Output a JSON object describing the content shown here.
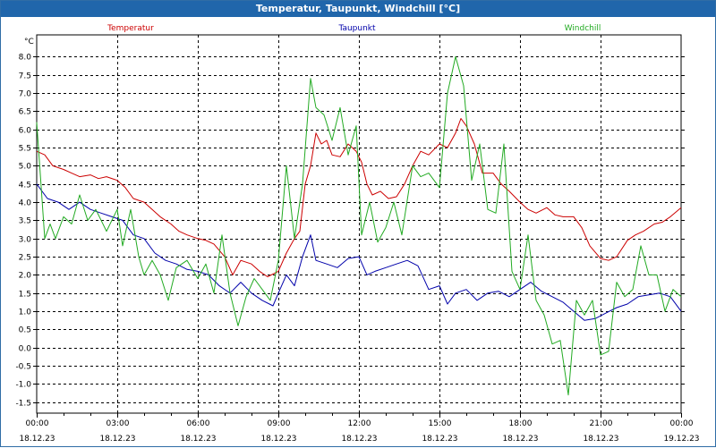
{
  "window": {
    "title": "Temperatur, Taupunkt, Windchill [°C]"
  },
  "chart_data": {
    "type": "line",
    "title": "Temperatur, Taupunkt, Windchill [°C]",
    "ylabel": "°C",
    "ylim": [
      -1.8,
      8.6
    ],
    "yticks": [
      8.0,
      7.5,
      7.0,
      6.5,
      6.0,
      5.5,
      5.0,
      4.5,
      4.0,
      3.5,
      3.0,
      2.5,
      2.0,
      1.5,
      1.0,
      0.5,
      0.0,
      -0.5,
      -1.0,
      -1.5
    ],
    "ytick_labels": [
      "8.0",
      "7.5",
      "7.0",
      "6.5",
      "6.0",
      "5.5",
      "5.0",
      "4.5",
      "4.0",
      "3.5",
      "3.0",
      "2.5",
      "2.0",
      "1.5",
      "1.0",
      "0.5",
      "0.0",
      "-0.5",
      "-1.0",
      "-1.5"
    ],
    "xlim": [
      0,
      24
    ],
    "xticks": [
      {
        "x": 0,
        "time": "00:00",
        "date": "18.12.23"
      },
      {
        "x": 3,
        "time": "03:00",
        "date": "18.12.23"
      },
      {
        "x": 6,
        "time": "06:00",
        "date": "18.12.23"
      },
      {
        "x": 9,
        "time": "09:00",
        "date": "18.12.23"
      },
      {
        "x": 12,
        "time": "12:00",
        "date": "18.12.23"
      },
      {
        "x": 15,
        "time": "15:00",
        "date": "18.12.23"
      },
      {
        "x": 18,
        "time": "18:00",
        "date": "18.12.23"
      },
      {
        "x": 21,
        "time": "21:00",
        "date": "18.12.23"
      },
      {
        "x": 24,
        "time": "00:00",
        "date": "19.12.23"
      }
    ],
    "grid": true,
    "legend_position": "top",
    "series": [
      {
        "name": "Temperatur",
        "color": "#cc0000",
        "points": [
          [
            0,
            5.4
          ],
          [
            0.3,
            5.3
          ],
          [
            0.6,
            5.0
          ],
          [
            1,
            4.9
          ],
          [
            1.3,
            4.8
          ],
          [
            1.6,
            4.7
          ],
          [
            2,
            4.75
          ],
          [
            2.3,
            4.65
          ],
          [
            2.6,
            4.7
          ],
          [
            3,
            4.6
          ],
          [
            3.3,
            4.4
          ],
          [
            3.6,
            4.1
          ],
          [
            4,
            4.0
          ],
          [
            4.3,
            3.8
          ],
          [
            4.6,
            3.6
          ],
          [
            5,
            3.4
          ],
          [
            5.3,
            3.2
          ],
          [
            5.6,
            3.1
          ],
          [
            6,
            3.0
          ],
          [
            6.3,
            2.95
          ],
          [
            6.6,
            2.85
          ],
          [
            7,
            2.5
          ],
          [
            7.3,
            2.0
          ],
          [
            7.6,
            2.4
          ],
          [
            8,
            2.3
          ],
          [
            8.3,
            2.1
          ],
          [
            8.6,
            1.95
          ],
          [
            9,
            2.1
          ],
          [
            9.3,
            2.6
          ],
          [
            9.6,
            3.0
          ],
          [
            9.8,
            3.2
          ],
          [
            10,
            4.5
          ],
          [
            10.2,
            5.0
          ],
          [
            10.4,
            5.9
          ],
          [
            10.6,
            5.6
          ],
          [
            10.8,
            5.7
          ],
          [
            11,
            5.3
          ],
          [
            11.3,
            5.25
          ],
          [
            11.6,
            5.6
          ],
          [
            11.9,
            5.4
          ],
          [
            12.1,
            5.1
          ],
          [
            12.3,
            4.5
          ],
          [
            12.5,
            4.2
          ],
          [
            12.8,
            4.3
          ],
          [
            13.1,
            4.1
          ],
          [
            13.4,
            4.15
          ],
          [
            13.7,
            4.5
          ],
          [
            14,
            5.0
          ],
          [
            14.3,
            5.4
          ],
          [
            14.6,
            5.3
          ],
          [
            15,
            5.6
          ],
          [
            15.3,
            5.5
          ],
          [
            15.6,
            5.9
          ],
          [
            15.8,
            6.3
          ],
          [
            16,
            6.1
          ],
          [
            16.3,
            5.6
          ],
          [
            16.6,
            4.8
          ],
          [
            17,
            4.8
          ],
          [
            17.3,
            4.5
          ],
          [
            17.6,
            4.3
          ],
          [
            18,
            4.0
          ],
          [
            18.3,
            3.8
          ],
          [
            18.6,
            3.7
          ],
          [
            19,
            3.85
          ],
          [
            19.3,
            3.65
          ],
          [
            19.6,
            3.6
          ],
          [
            20,
            3.6
          ],
          [
            20.3,
            3.3
          ],
          [
            20.6,
            2.8
          ],
          [
            21,
            2.45
          ],
          [
            21.3,
            2.4
          ],
          [
            21.6,
            2.5
          ],
          [
            22,
            2.95
          ],
          [
            22.3,
            3.1
          ],
          [
            22.6,
            3.2
          ],
          [
            23,
            3.4
          ],
          [
            23.3,
            3.45
          ],
          [
            23.6,
            3.6
          ],
          [
            24,
            3.85
          ]
        ]
      },
      {
        "name": "Taupunkt",
        "color": "#0000aa",
        "points": [
          [
            0,
            4.5
          ],
          [
            0.4,
            4.1
          ],
          [
            0.8,
            4.0
          ],
          [
            1.2,
            3.8
          ],
          [
            1.6,
            4.0
          ],
          [
            2,
            3.8
          ],
          [
            2.4,
            3.7
          ],
          [
            2.8,
            3.6
          ],
          [
            3.2,
            3.5
          ],
          [
            3.6,
            3.1
          ],
          [
            4,
            3.0
          ],
          [
            4.4,
            2.6
          ],
          [
            4.8,
            2.4
          ],
          [
            5.2,
            2.3
          ],
          [
            5.6,
            2.15
          ],
          [
            6,
            2.1
          ],
          [
            6.4,
            2.0
          ],
          [
            6.8,
            1.7
          ],
          [
            7.2,
            1.5
          ],
          [
            7.6,
            1.8
          ],
          [
            8,
            1.5
          ],
          [
            8.4,
            1.3
          ],
          [
            8.8,
            1.15
          ],
          [
            9,
            1.5
          ],
          [
            9.3,
            2.0
          ],
          [
            9.6,
            1.7
          ],
          [
            9.9,
            2.5
          ],
          [
            10.2,
            3.1
          ],
          [
            10.4,
            2.4
          ],
          [
            10.8,
            2.3
          ],
          [
            11.2,
            2.2
          ],
          [
            11.6,
            2.45
          ],
          [
            12,
            2.5
          ],
          [
            12.3,
            2.0
          ],
          [
            12.6,
            2.1
          ],
          [
            13,
            2.2
          ],
          [
            13.4,
            2.3
          ],
          [
            13.8,
            2.4
          ],
          [
            14.2,
            2.25
          ],
          [
            14.6,
            1.6
          ],
          [
            15,
            1.7
          ],
          [
            15.3,
            1.2
          ],
          [
            15.6,
            1.5
          ],
          [
            16,
            1.6
          ],
          [
            16.4,
            1.3
          ],
          [
            16.8,
            1.5
          ],
          [
            17.2,
            1.55
          ],
          [
            17.6,
            1.4
          ],
          [
            18,
            1.6
          ],
          [
            18.4,
            1.8
          ],
          [
            18.8,
            1.55
          ],
          [
            19.2,
            1.4
          ],
          [
            19.6,
            1.25
          ],
          [
            20,
            1.0
          ],
          [
            20.4,
            0.75
          ],
          [
            20.8,
            0.8
          ],
          [
            21.2,
            0.95
          ],
          [
            21.6,
            1.1
          ],
          [
            22,
            1.2
          ],
          [
            22.4,
            1.4
          ],
          [
            22.8,
            1.45
          ],
          [
            23.2,
            1.5
          ],
          [
            23.6,
            1.4
          ],
          [
            24,
            1.0
          ]
        ]
      },
      {
        "name": "Windchill",
        "color": "#22aa22",
        "points": [
          [
            0,
            6.2
          ],
          [
            0.3,
            3.0
          ],
          [
            0.5,
            3.4
          ],
          [
            0.7,
            3.0
          ],
          [
            1,
            3.6
          ],
          [
            1.3,
            3.4
          ],
          [
            1.6,
            4.2
          ],
          [
            1.9,
            3.5
          ],
          [
            2.2,
            3.8
          ],
          [
            2.6,
            3.2
          ],
          [
            3,
            3.8
          ],
          [
            3.2,
            2.8
          ],
          [
            3.5,
            3.8
          ],
          [
            3.8,
            2.5
          ],
          [
            4,
            2.0
          ],
          [
            4.3,
            2.4
          ],
          [
            4.6,
            2.0
          ],
          [
            4.9,
            1.3
          ],
          [
            5.2,
            2.2
          ],
          [
            5.6,
            2.4
          ],
          [
            6,
            1.9
          ],
          [
            6.3,
            2.3
          ],
          [
            6.6,
            1.5
          ],
          [
            6.9,
            3.1
          ],
          [
            7.2,
            1.5
          ],
          [
            7.5,
            0.6
          ],
          [
            7.8,
            1.4
          ],
          [
            8.1,
            1.9
          ],
          [
            8.4,
            1.6
          ],
          [
            8.7,
            1.3
          ],
          [
            9,
            2.4
          ],
          [
            9.3,
            5.0
          ],
          [
            9.6,
            3.0
          ],
          [
            9.9,
            4.5
          ],
          [
            10.2,
            7.4
          ],
          [
            10.4,
            6.6
          ],
          [
            10.7,
            6.4
          ],
          [
            11,
            5.7
          ],
          [
            11.3,
            6.6
          ],
          [
            11.6,
            5.3
          ],
          [
            11.9,
            6.1
          ],
          [
            12.1,
            3.1
          ],
          [
            12.4,
            4.0
          ],
          [
            12.7,
            2.9
          ],
          [
            13,
            3.3
          ],
          [
            13.3,
            4.0
          ],
          [
            13.6,
            3.1
          ],
          [
            14,
            5.0
          ],
          [
            14.3,
            4.7
          ],
          [
            14.6,
            4.8
          ],
          [
            15,
            4.4
          ],
          [
            15.3,
            7.0
          ],
          [
            15.6,
            8.0
          ],
          [
            15.9,
            7.2
          ],
          [
            16.2,
            4.6
          ],
          [
            16.5,
            5.6
          ],
          [
            16.8,
            3.8
          ],
          [
            17.1,
            3.7
          ],
          [
            17.4,
            5.6
          ],
          [
            17.7,
            2.1
          ],
          [
            18,
            1.6
          ],
          [
            18.3,
            3.1
          ],
          [
            18.6,
            1.3
          ],
          [
            18.9,
            0.9
          ],
          [
            19.2,
            0.1
          ],
          [
            19.5,
            0.2
          ],
          [
            19.8,
            -1.3
          ],
          [
            20.1,
            1.3
          ],
          [
            20.4,
            0.9
          ],
          [
            20.7,
            1.3
          ],
          [
            21,
            -0.2
          ],
          [
            21.3,
            -0.1
          ],
          [
            21.6,
            1.8
          ],
          [
            21.9,
            1.4
          ],
          [
            22.2,
            1.6
          ],
          [
            22.5,
            2.8
          ],
          [
            22.8,
            2.0
          ],
          [
            23.1,
            2.0
          ],
          [
            23.4,
            1.0
          ],
          [
            23.7,
            1.6
          ],
          [
            24,
            1.4
          ]
        ]
      }
    ]
  }
}
